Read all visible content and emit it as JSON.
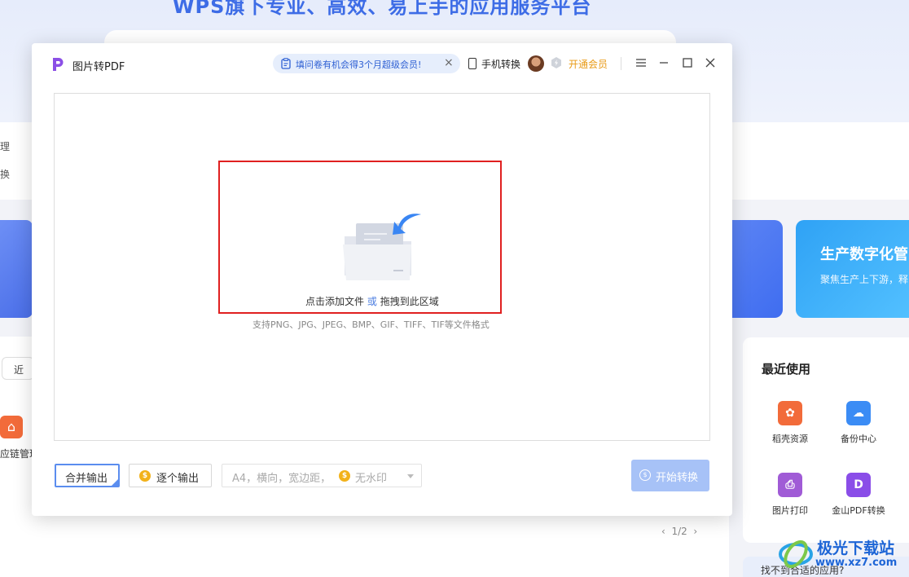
{
  "background": {
    "headline": "WPS旗下专业、高效、易上手的应用服务平台",
    "left_labels": [
      "理",
      "换"
    ],
    "banner_right_title": "生产数字化管",
    "banner_right_subtitle": "聚焦生产上下游，释",
    "left_button_label": "近",
    "left_app_label": "应链管理",
    "pager": "1/2",
    "recent": {
      "title": "最近使用",
      "items": [
        {
          "label": "稻壳资源",
          "icon": "docer-icon",
          "color": "#f26b3a"
        },
        {
          "label": "备份中心",
          "icon": "cloud-backup-icon",
          "color": "#3b8cf5"
        },
        {
          "label": "图片打印",
          "icon": "printer-icon",
          "color": "#a05bd6"
        },
        {
          "label": "金山PDF转换",
          "icon": "pdf-convert-icon",
          "color": "#8a4de8"
        }
      ]
    },
    "bottom_box_text": "找不到合适的应用?",
    "watermark": {
      "text": "极光下载站",
      "url": "www.xz7.com"
    }
  },
  "dialog": {
    "title": "图片转PDF",
    "promo_text": "填问卷有机会得3个月超级会员!",
    "promo_close": "×",
    "mobile_convert": "手机转换",
    "vip_label": "开通会员",
    "dropzone": {
      "main_text_1": "点击添加文件",
      "or": "或",
      "main_text_2": "拖拽到此区域",
      "formats": "支持PNG、JPG、JPEG、BMP、GIF、TIFF、TIF等文件格式"
    },
    "options": {
      "merge_output": "合并输出",
      "single_output": "逐个输出",
      "page_settings": "A4，横向，宽边距，",
      "watermark_option": "无水印"
    },
    "start_button": "开始转换"
  },
  "colors": {
    "accent": "#5b8def",
    "highlight_border": "#e02020",
    "vip": "#e89a16",
    "start_button": "#a7c2f7"
  }
}
